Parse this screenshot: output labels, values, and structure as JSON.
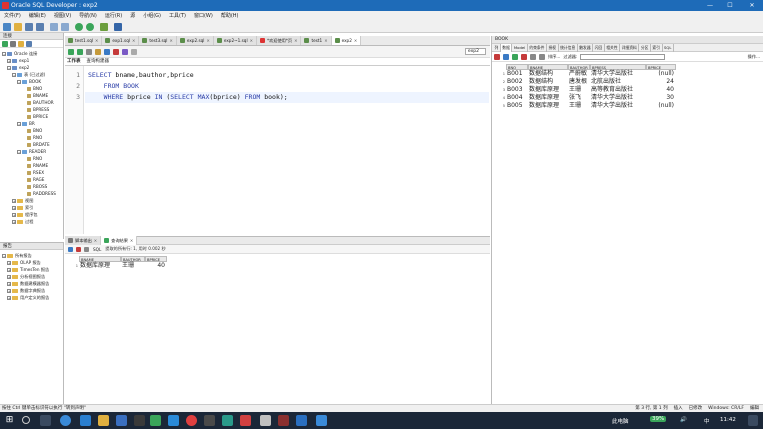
{
  "window": {
    "title": "Oracle SQL Developer : exp2",
    "minimize": "—",
    "maximize": "☐",
    "close": "✕"
  },
  "menu": [
    "文件(F)",
    "编辑(E)",
    "视图(V)",
    "导航(N)",
    "运行(R)",
    "源",
    "小组(G)",
    "工具(T)",
    "窗口(W)",
    "帮助(H)"
  ],
  "connections": {
    "header": "连接",
    "tree": [
      {
        "indent": 0,
        "toggle": "−",
        "icon": "db",
        "label": "Oracle 连接"
      },
      {
        "indent": 1,
        "toggle": "+",
        "icon": "conn",
        "label": "exp1"
      },
      {
        "indent": 1,
        "toggle": "−",
        "icon": "conn",
        "label": "exp2"
      },
      {
        "indent": 2,
        "toggle": "−",
        "icon": "tbl",
        "label": "表 (已过滤)"
      },
      {
        "indent": 3,
        "toggle": "−",
        "icon": "tbl",
        "label": "BOOK"
      },
      {
        "indent": 4,
        "toggle": "",
        "icon": "col",
        "label": "BNO"
      },
      {
        "indent": 4,
        "toggle": "",
        "icon": "col",
        "label": "BNAME"
      },
      {
        "indent": 4,
        "toggle": "",
        "icon": "col",
        "label": "BAUTHOR"
      },
      {
        "indent": 4,
        "toggle": "",
        "icon": "col",
        "label": "BPRESS"
      },
      {
        "indent": 4,
        "toggle": "",
        "icon": "col",
        "label": "BPRICE"
      },
      {
        "indent": 3,
        "toggle": "−",
        "icon": "tbl",
        "label": "BR"
      },
      {
        "indent": 4,
        "toggle": "",
        "icon": "col",
        "label": "BNO"
      },
      {
        "indent": 4,
        "toggle": "",
        "icon": "col",
        "label": "RNO"
      },
      {
        "indent": 4,
        "toggle": "",
        "icon": "col",
        "label": "BRDATE"
      },
      {
        "indent": 3,
        "toggle": "−",
        "icon": "tbl",
        "label": "READER"
      },
      {
        "indent": 4,
        "toggle": "",
        "icon": "col",
        "label": "RNO"
      },
      {
        "indent": 4,
        "toggle": "",
        "icon": "col",
        "label": "RNAME"
      },
      {
        "indent": 4,
        "toggle": "",
        "icon": "col",
        "label": "RSEX"
      },
      {
        "indent": 4,
        "toggle": "",
        "icon": "col",
        "label": "RAGE"
      },
      {
        "indent": 4,
        "toggle": "",
        "icon": "col",
        "label": "RBOSS"
      },
      {
        "indent": 4,
        "toggle": "",
        "icon": "col",
        "label": "RADDRESS"
      },
      {
        "indent": 2,
        "toggle": "+",
        "icon": "folder",
        "label": "视图"
      },
      {
        "indent": 2,
        "toggle": "+",
        "icon": "folder",
        "label": "索引"
      },
      {
        "indent": 2,
        "toggle": "+",
        "icon": "folder",
        "label": "程序包"
      },
      {
        "indent": 2,
        "toggle": "+",
        "icon": "folder",
        "label": "过程"
      }
    ]
  },
  "reports": {
    "header": "报告",
    "tree": [
      {
        "indent": 0,
        "toggle": "−",
        "icon": "folder",
        "label": "所有报告"
      },
      {
        "indent": 1,
        "toggle": "+",
        "icon": "folder",
        "label": "OLAP 报告"
      },
      {
        "indent": 1,
        "toggle": "+",
        "icon": "folder",
        "label": "TimesTen 报告"
      },
      {
        "indent": 1,
        "toggle": "+",
        "icon": "folder",
        "label": "分析视图报告"
      },
      {
        "indent": 1,
        "toggle": "+",
        "icon": "folder",
        "label": "数据建模器报告"
      },
      {
        "indent": 1,
        "toggle": "+",
        "icon": "folder",
        "label": "数据字典报告"
      },
      {
        "indent": 1,
        "toggle": "+",
        "icon": "folder",
        "label": "用户定义的报告"
      }
    ]
  },
  "doc_tabs": [
    {
      "label": "test1.sql",
      "active": false
    },
    {
      "label": "exp1.sql",
      "active": false
    },
    {
      "label": "test3.sql",
      "active": false
    },
    {
      "label": "exp2.sql",
      "active": false
    },
    {
      "label": "exp2~1.sql",
      "active": false
    },
    {
      "label": "*欢迎使用*页",
      "active": false
    },
    {
      "label": "test1",
      "active": false
    },
    {
      "label": "exp2",
      "active": true
    }
  ],
  "worksheet": {
    "connection_selector": "exp2",
    "subtabs": [
      "工作表",
      "查询构建器"
    ],
    "lines": [
      "1",
      "2",
      "3"
    ]
  },
  "output": {
    "tabs": [
      "脚本输出",
      "查询结果"
    ],
    "status": "提取的所有行: 1, 用时 0.002 秒",
    "sql_label": "SQL",
    "columns": [
      "BNAME",
      "BAUTHOR",
      "BPRICE"
    ],
    "rows": [
      {
        "n": "1",
        "cells": [
          "数据库原理",
          "王珊",
          "40"
        ]
      }
    ]
  },
  "table_panel": {
    "title": "BOOK",
    "tabs": [
      "列",
      "数据",
      "Model",
      "约束条件",
      "授权",
      "统计信息",
      "触发器",
      "闪回",
      "相关性",
      "详细资料",
      "分区",
      "索引",
      "SQL"
    ],
    "actions_label": "操作...",
    "sort_label": "排序...",
    "filter_label": "过滤器:",
    "columns": [
      "BNO",
      "BNAME",
      "BAUTHOR",
      "BPRESS",
      "BPRICE"
    ],
    "rows": [
      {
        "n": "1",
        "cells": [
          "B001",
          "数据结构",
          "严蔚敏",
          "清华大学出版社",
          "(null)"
        ]
      },
      {
        "n": "2",
        "cells": [
          "B002",
          "数据结构",
          "唐发根",
          "北航出版社",
          "24"
        ]
      },
      {
        "n": "3",
        "cells": [
          "B003",
          "数据库原理",
          "王珊",
          "高等教育出版社",
          "40"
        ]
      },
      {
        "n": "4",
        "cells": [
          "B004",
          "数据库原理",
          "张飞",
          "清华大学出版社",
          "30"
        ]
      },
      {
        "n": "5",
        "cells": [
          "B005",
          "数据库原理",
          "王珊",
          "清华大学出版社",
          "(null)"
        ]
      }
    ]
  },
  "statusbar": {
    "text": "按住 Ctrl 键单击标识符以执行 \"转到声明\"",
    "line_col": "第 3 行, 第 1 列",
    "insert_mode": "插入",
    "modified": "已修改",
    "os": "Windows: CR/LF",
    "encoding": "编辑"
  },
  "taskbar": {
    "time": "11:42",
    "battery": "39%",
    "lang": "中",
    "computer": "此电脑"
  },
  "colors": {
    "titlebar": "#1e6bb8",
    "keyword": "#2b3ea8",
    "taskbar": "#1b2738"
  }
}
